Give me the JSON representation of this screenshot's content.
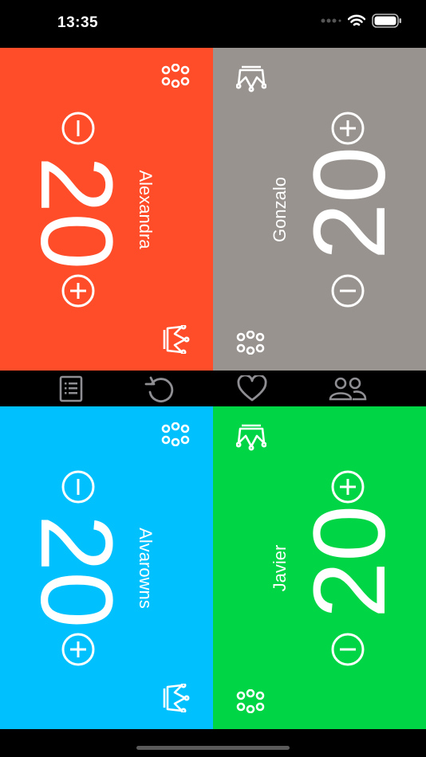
{
  "status": {
    "time": "13:35"
  },
  "colors": {
    "p1": "#ff4d2a",
    "p2": "#98938f",
    "p3": "#00c1fe",
    "p4": "#00d645",
    "toolbar_icon": "#8e8e93"
  },
  "players": [
    {
      "name": "Alexandra",
      "life": "20"
    },
    {
      "name": "Gonzalo",
      "life": "20"
    },
    {
      "name": "Alvarowns",
      "life": "20"
    },
    {
      "name": "Javier",
      "life": "20"
    }
  ],
  "toolbar": [
    "notes-icon",
    "reset-icon",
    "favorite-icon",
    "players-icon"
  ]
}
